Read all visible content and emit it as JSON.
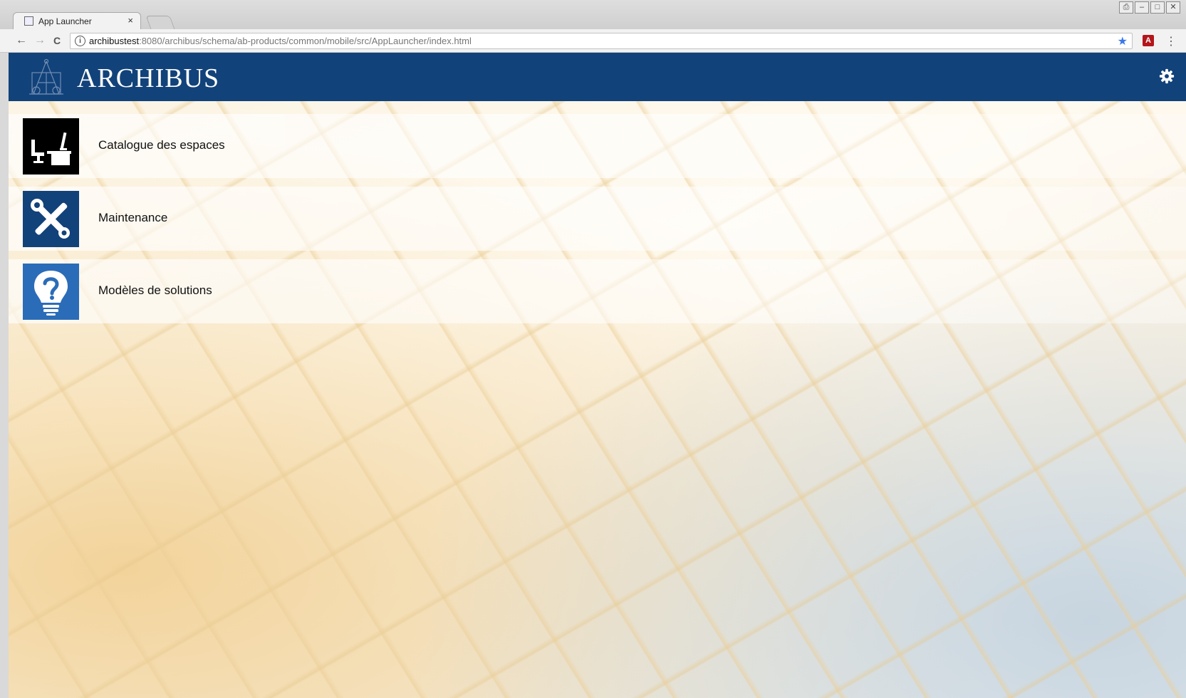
{
  "browser": {
    "tab_title": "App Launcher",
    "tab_close": "×",
    "url_host": "archibustest",
    "url_rest": ":8080/archibus/schema/ab-products/common/mobile/src/AppLauncher/index.html",
    "back": "←",
    "forward": "→",
    "reload": "C",
    "info": "i",
    "star": "★",
    "menu": "⋮",
    "ext_label": "A",
    "window_buttons": [
      "⎙",
      "–",
      "□",
      "✕"
    ]
  },
  "header": {
    "logo_text": "ARCHIBUS",
    "brand_color": "#12427a",
    "settings_icon": "gear-icon"
  },
  "apps": [
    {
      "label": "Catalogue des espaces",
      "icon": "workspace-desk-icon",
      "tile_color": "#000000"
    },
    {
      "label": "Maintenance",
      "icon": "tools-icon",
      "tile_color": "#12427a"
    },
    {
      "label": "Modèles de solutions",
      "icon": "lightbulb-question-icon",
      "tile_color": "#2b6cb8"
    }
  ]
}
